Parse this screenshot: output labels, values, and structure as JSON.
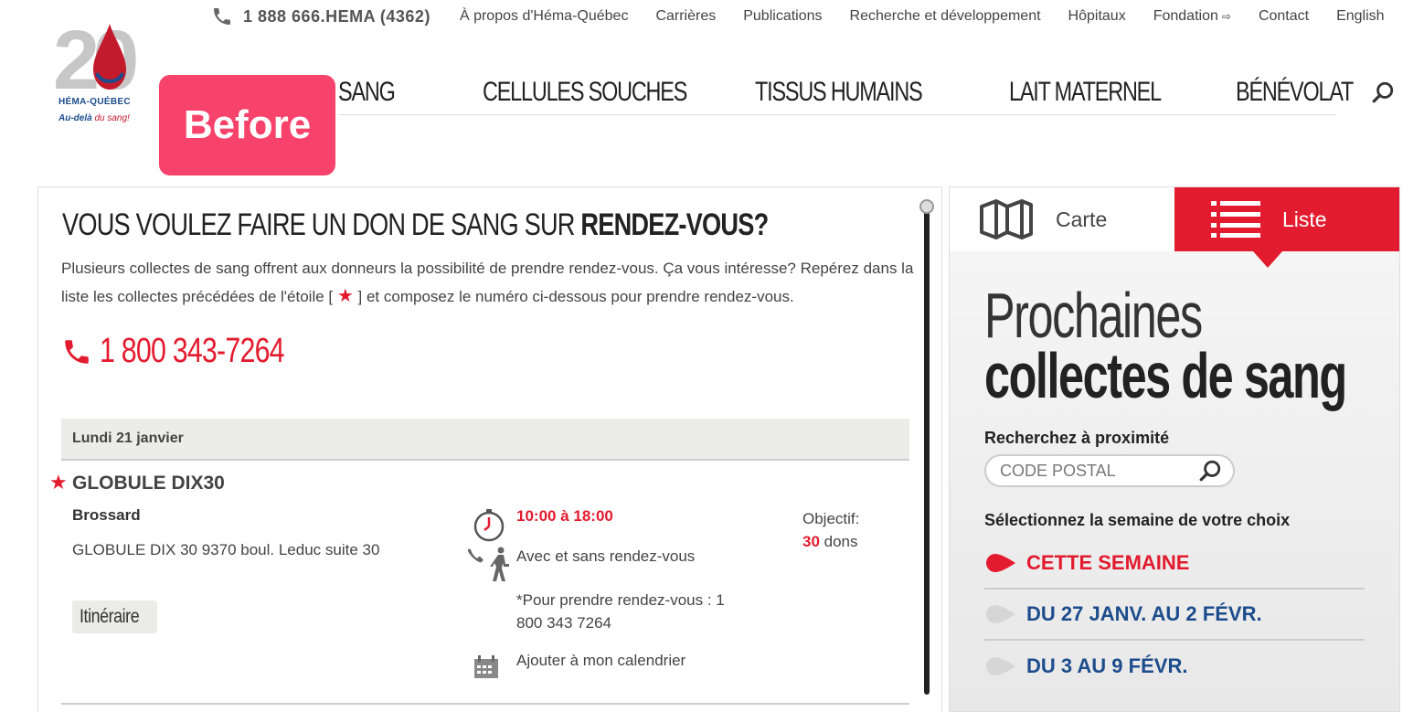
{
  "top_bar": {
    "phone": "1 888 666.HEMA (4362)",
    "links": [
      "À propos d'Héma-Québec",
      "Carrières",
      "Publications",
      "Recherche et développement",
      "Hôpitaux",
      "Fondation",
      "Contact",
      "English"
    ]
  },
  "logo": {
    "number": "20",
    "brand": "HÉMA-QUÉBEC",
    "tagline_bold": "Au-delà",
    "tagline_rest": " du sang!"
  },
  "badge": "Before",
  "main_nav": [
    "SANG",
    "CELLULES SOUCHES",
    "TISSUS HUMAINS",
    "LAIT MATERNEL",
    "BÉNÉVOLAT"
  ],
  "content": {
    "heading_light": "VOUS VOULEZ FAIRE UN DON DE SANG SUR ",
    "heading_bold": "RENDEZ-VOUS?",
    "intro_part1": "Plusieurs collectes de sang offrent aux donneurs la possibilité de prendre rendez-vous. Ça vous intéresse? Repérez dans la liste les collectes précédées de l'étoile [ ",
    "intro_star": "★",
    "intro_part2": " ] et composez le numéro ci-dessous pour prendre rendez-vous.",
    "phone": "1 800 343-7264",
    "day_header": "Lundi 21 janvier",
    "event": {
      "star": "★",
      "title": "GLOBULE DIX30",
      "city": "Brossard",
      "address": "GLOBULE DIX 30 9370 boul. Leduc suite 30",
      "itinerary_button": "Itinéraire",
      "hours": "10:00 à 18:00",
      "mode": "Avec et sans rendez-vous",
      "note": "*Pour prendre rendez-vous : 1 800 343 7264",
      "add_calendar": "Ajouter à mon calendrier",
      "objective_label": "Objectif:",
      "objective_value": "30",
      "objective_unit": " dons"
    }
  },
  "sidebar": {
    "tab_map": "Carte",
    "tab_list": "Liste",
    "title_line1": "Prochaines",
    "title_line2": "collectes de sang",
    "search_label": "Recherchez à proximité",
    "postal_placeholder": "CODE POSTAL",
    "week_label": "Sélectionnez la semaine de votre choix",
    "weeks": [
      "CETTE SEMAINE",
      "DU 27 JANV. AU 2 FÉVR.",
      "DU 3 AU 9 FÉVR."
    ]
  },
  "colors": {
    "brand_red": "#e31b2e",
    "brand_blue": "#1c4c8c",
    "badge_pink": "#f7436b"
  }
}
